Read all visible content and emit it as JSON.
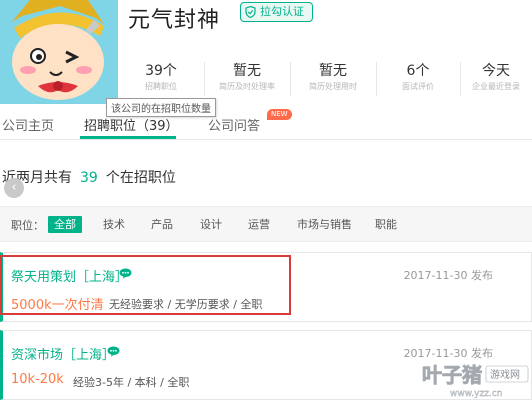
{
  "company": {
    "name": "元气封神",
    "verify_label": "拉勾认证"
  },
  "stats": [
    {
      "value": "39个",
      "label": "招聘职位"
    },
    {
      "value": "暂无",
      "label": "简历及时处理率"
    },
    {
      "value": "暂无",
      "label": "简历处理用时"
    },
    {
      "value": "6个",
      "label": "面试评价"
    },
    {
      "value": "今天",
      "label": "企业最近登录"
    }
  ],
  "tooltip": "该公司的在招职位数量",
  "tabs": [
    {
      "label": "公司主页"
    },
    {
      "label": "招聘职位（39）"
    },
    {
      "label": "公司问答"
    }
  ],
  "new_badge": "NEW",
  "summary": {
    "prefix": "近两月共有",
    "count": "39",
    "suffix": "个在招职位"
  },
  "filter": {
    "label": "职位：",
    "items": [
      "全部",
      "技术",
      "产品",
      "设计",
      "运营",
      "市场与销售",
      "职能"
    ]
  },
  "jobs": [
    {
      "title": "祭天用策划［上海］",
      "date": "2017-11-30 发布",
      "salary": "5000k一次付清",
      "requirements": "无经验要求 / 无学历要求 / 全职"
    },
    {
      "title": "资深市场［上海］",
      "date": "2017-11-30 发布",
      "salary": "10k-20k",
      "requirements": "经验3-5年 / 本科 / 全职"
    }
  ],
  "watermark": {
    "text": "叶子猪",
    "sub": "游戏网",
    "url": "www.yzz.cn"
  },
  "colors": {
    "accent": "#00b38a",
    "salary": "#ff7a45",
    "highlight": "#d93a3a"
  }
}
